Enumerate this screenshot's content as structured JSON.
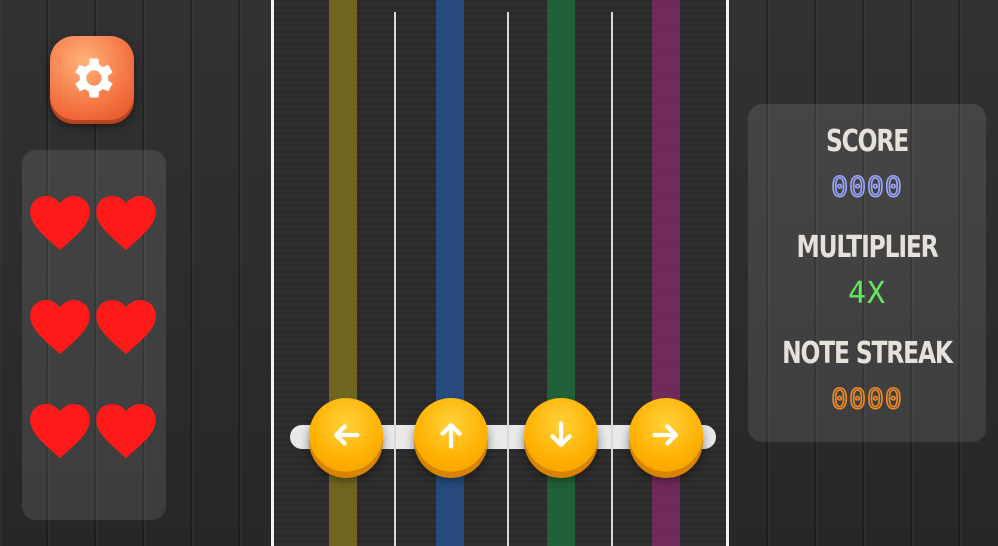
{
  "settings": {
    "icon": "gear-icon"
  },
  "lives": {
    "count": 6,
    "icon": "heart-icon",
    "color": "#ff1a1a"
  },
  "board": {
    "lane_colors": [
      "#7a7020",
      "#24508a",
      "#1f6a38",
      "#7a2a62"
    ],
    "buttons": [
      {
        "direction": "left",
        "icon": "arrow-left-icon"
      },
      {
        "direction": "up",
        "icon": "arrow-up-icon"
      },
      {
        "direction": "down",
        "icon": "arrow-down-icon"
      },
      {
        "direction": "right",
        "icon": "arrow-right-icon"
      }
    ]
  },
  "stats": {
    "score_label": "SCORE",
    "score_value": "0000",
    "multiplier_label": "MULTIPLIER",
    "multiplier_value": "4X",
    "streak_label": "NOTE STREAK",
    "streak_value": "0000"
  }
}
